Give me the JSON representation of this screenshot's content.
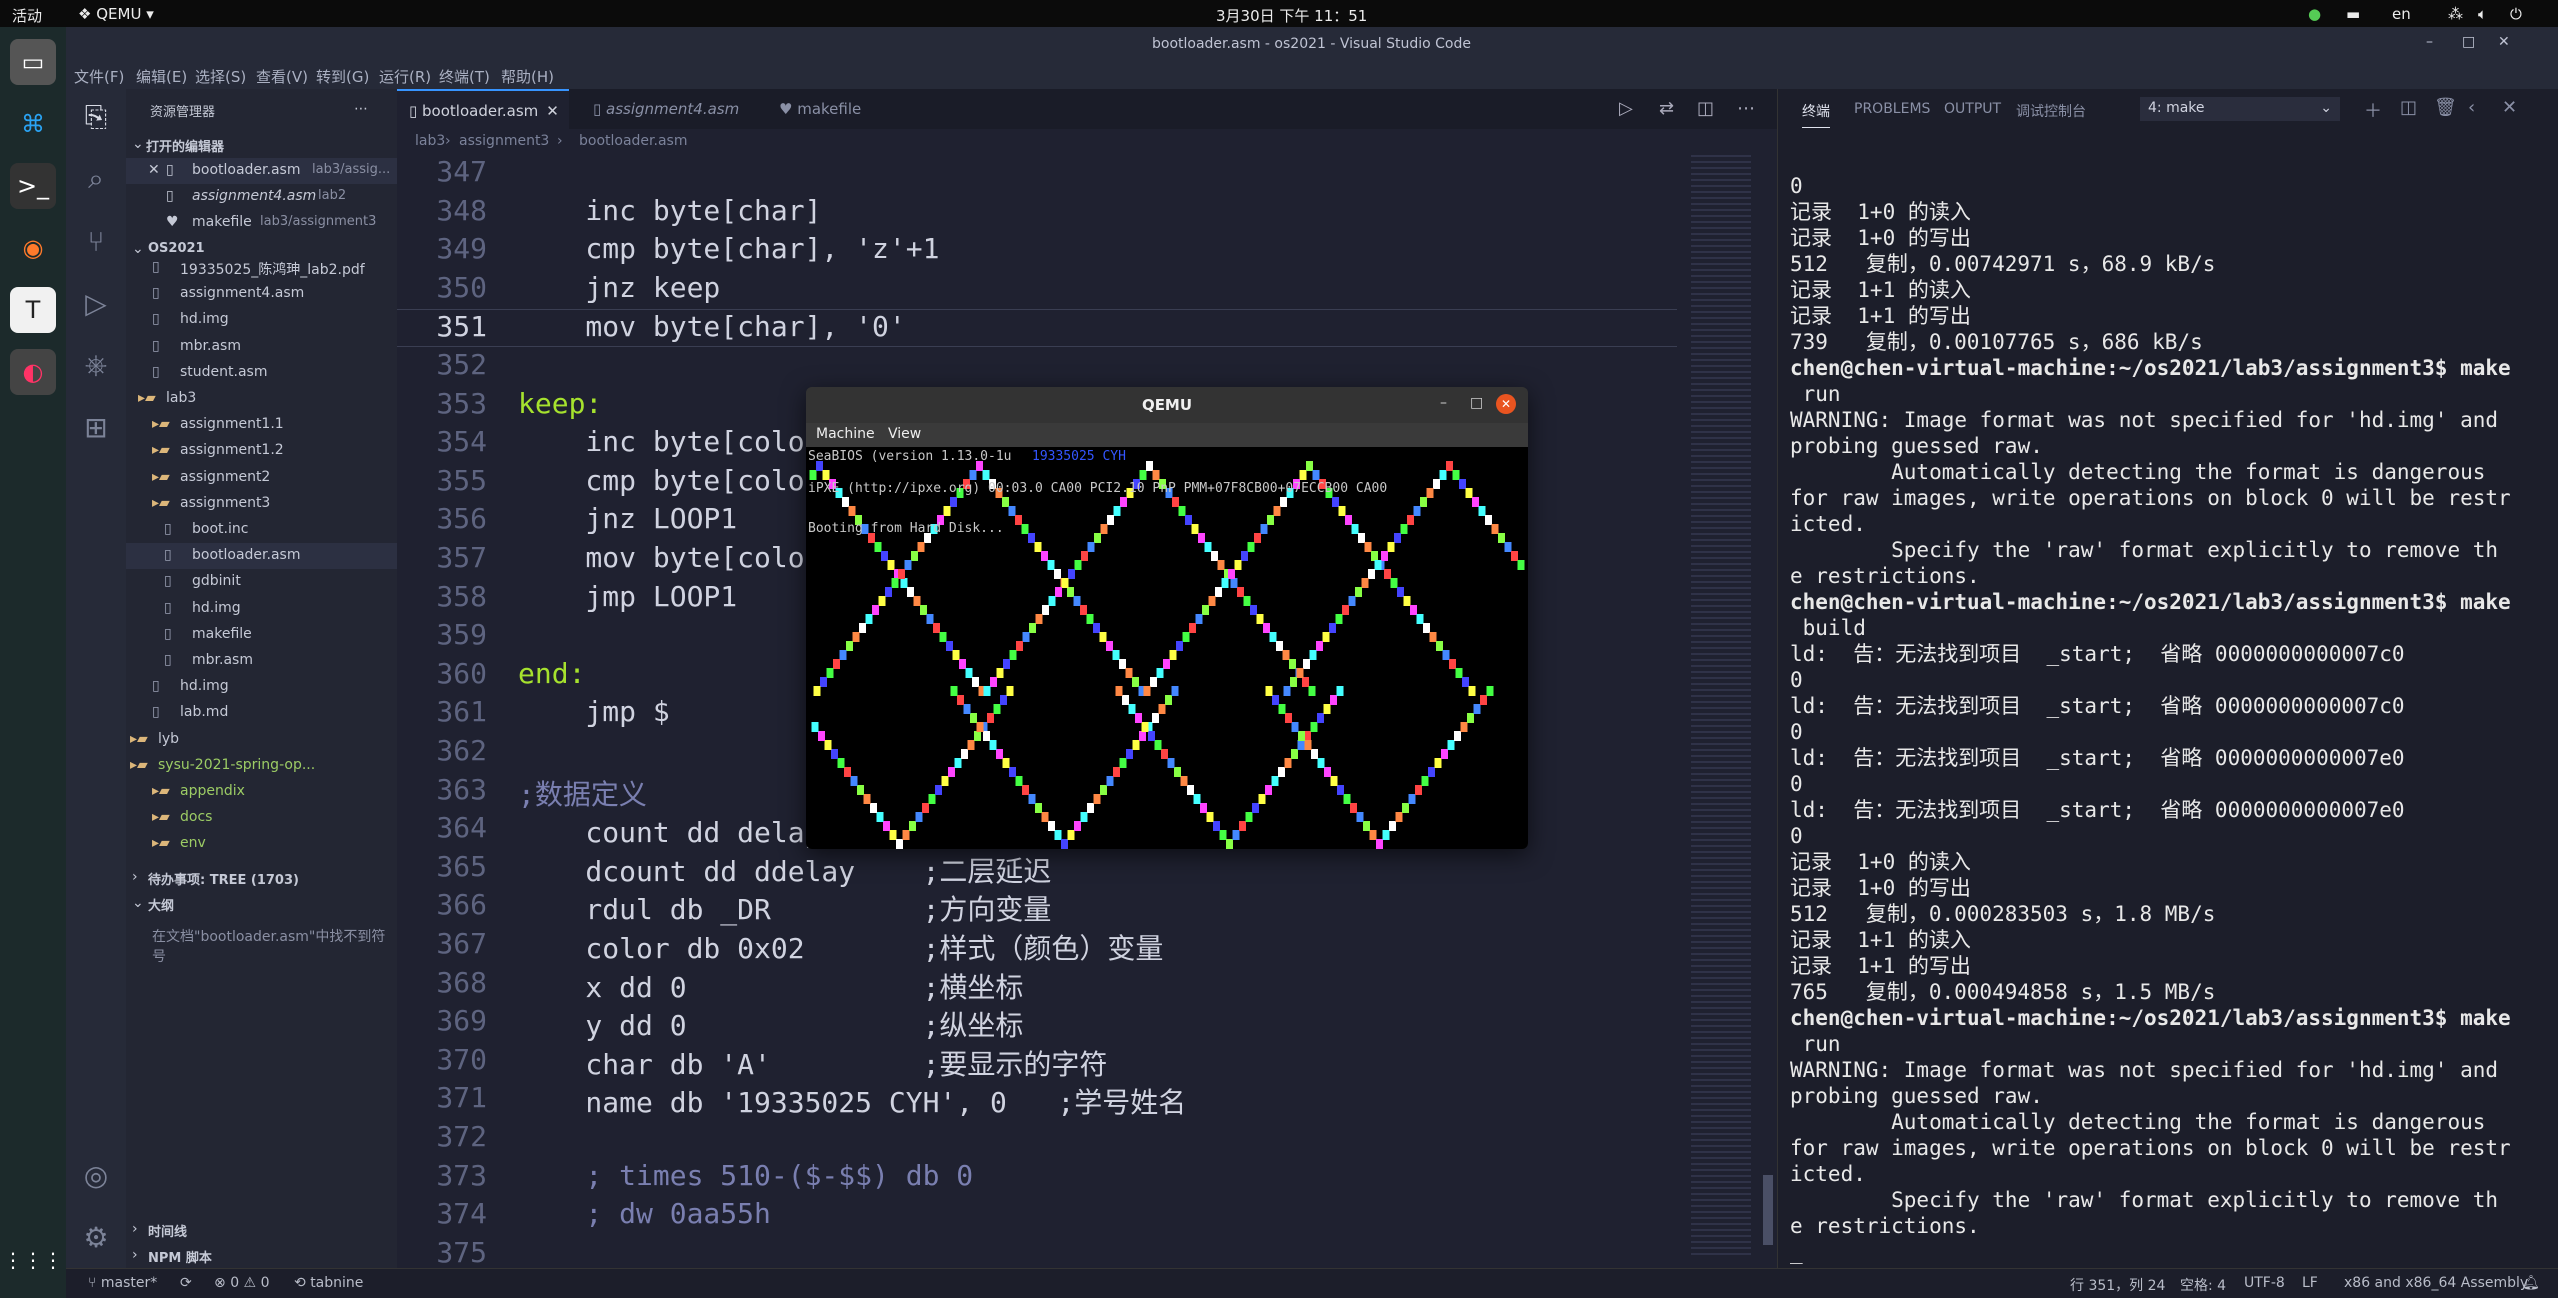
{
  "topbar": {
    "activities": "活动",
    "app": "QEMU",
    "clock": "3月30日 下午 11：51",
    "lang": "en"
  },
  "window": {
    "title": "bootloader.asm - os2021 - Visual Studio Code"
  },
  "menu": [
    "文件(F)",
    "编辑(E)",
    "选择(S)",
    "查看(V)",
    "转到(G)",
    "运行(R)",
    "终端(T)",
    "帮助(H)"
  ],
  "sidebar": {
    "header": "资源管理器",
    "open_editors": "打开的编辑器",
    "open_files": [
      {
        "name": "bootloader.asm",
        "path": "lab3/assig..."
      },
      {
        "name": "assignment4.asm",
        "path": "lab2"
      },
      {
        "name": "makefile",
        "path": "lab3/assignment3"
      }
    ],
    "project": "OS2021",
    "tree": [
      "19335025_陈鸿珅_lab2.pdf",
      "assignment4.asm",
      "hd.img",
      "mbr.asm",
      "student.asm",
      "lab3",
      "assignment1.1",
      "assignment1.2",
      "assignment2",
      "assignment3",
      "boot.inc",
      "bootloader.asm",
      "gdbinit",
      "hd.img",
      "makefile",
      "mbr.asm",
      "hd.img",
      "lab.md",
      "lyb",
      "sysu-2021-spring-op...",
      "appendix",
      "docs",
      "env"
    ],
    "todo": "待办事项: TREE (1703)",
    "outline": "大纲",
    "outline_msg": "在文档\"bootloader.asm\"中找不到符号",
    "timeline": "时间线",
    "npm": "NPM 脚本"
  },
  "tabs": [
    {
      "label": "bootloader.asm"
    },
    {
      "label": "assignment4.asm"
    },
    {
      "label": "makefile"
    }
  ],
  "breadcrumb": [
    "lab3",
    "assignment3",
    "bootloader.asm"
  ],
  "code": [
    {
      "n": "347",
      "t": ""
    },
    {
      "n": "348",
      "t": "    inc byte[char]"
    },
    {
      "n": "349",
      "t": "    cmp byte[char], 'z'+1"
    },
    {
      "n": "350",
      "t": "    jnz keep"
    },
    {
      "n": "351",
      "t": "    mov byte[char], '0'"
    },
    {
      "n": "352",
      "t": ""
    },
    {
      "n": "353",
      "t": "keep:"
    },
    {
      "n": "354",
      "t": "    inc byte[color]"
    },
    {
      "n": "355",
      "t": "    cmp byte[color], 0x10"
    },
    {
      "n": "356",
      "t": "    jnz LOOP1"
    },
    {
      "n": "357",
      "t": "    mov byte[color], 0x02"
    },
    {
      "n": "358",
      "t": "    jmp LOOP1"
    },
    {
      "n": "359",
      "t": ""
    },
    {
      "n": "360",
      "t": "end:"
    },
    {
      "n": "361",
      "t": "    jmp $"
    },
    {
      "n": "362",
      "t": ""
    },
    {
      "n": "363",
      "t": ";数据定义"
    },
    {
      "n": "364",
      "t": "    count dd delay      ;一层延迟"
    },
    {
      "n": "365",
      "t": "    dcount dd ddelay    ;二层延迟"
    },
    {
      "n": "366",
      "t": "    rdul db _DR         ;方向变量"
    },
    {
      "n": "367",
      "t": "    color db 0x02       ;样式（颜色）变量"
    },
    {
      "n": "368",
      "t": "    x dd 0              ;横坐标"
    },
    {
      "n": "369",
      "t": "    y dd 0              ;纵坐标"
    },
    {
      "n": "370",
      "t": "    char db 'A'         ;要显示的字符"
    },
    {
      "n": "371",
      "t": "    name db '19335025 CYH', 0   ;学号姓名"
    },
    {
      "n": "372",
      "t": ""
    },
    {
      "n": "373",
      "t": "    ; times 510-($-$$) db 0"
    },
    {
      "n": "374",
      "t": "    ; dw 0aa55h"
    },
    {
      "n": "375",
      "t": ""
    }
  ],
  "panel": {
    "tabs": [
      "终端",
      "PROBLEMS",
      "OUTPUT",
      "调试控制台"
    ],
    "terminal_select": "4: make",
    "lines": [
      "0",
      "记录  1+0 的读入",
      "记录  1+0 的写出",
      "512   复制，0.00742971 s，68.9 kB/s",
      "记录  1+1 的读入",
      "记录  1+1 的写出",
      "739   复制，0.00107765 s，686 kB/s",
      "chen@chen-virtual-machine:~/os2021/lab3/assignment3$ make",
      " run",
      "WARNING: Image format was not specified for 'hd.img' and",
      "probing guessed raw.",
      "        Automatically detecting the format is dangerous",
      "for raw images, write operations on block 0 will be restr",
      "icted.",
      "        Specify the 'raw' format explicitly to remove th",
      "e restrictions.",
      "chen@chen-virtual-machine:~/os2021/lab3/assignment3$ make",
      " build",
      "ld:  告：无法找到项目  _start;  省略 0000000000007c0",
      "0",
      "ld:  告：无法找到项目  _start;  省略 0000000000007c0",
      "0",
      "ld:  告：无法找到项目  _start;  省略 0000000000007e0",
      "0",
      "ld:  告：无法找到项目  _start;  省略 0000000000007e0",
      "0",
      "记录  1+0 的读入",
      "记录  1+0 的写出",
      "512   复制，0.000283503 s，1.8 MB/s",
      "记录  1+1 的读入",
      "记录  1+1 的写出",
      "765   复制，0.000494858 s，1.5 MB/s",
      "chen@chen-virtual-machine:~/os2021/lab3/assignment3$ make",
      " run",
      "WARNING: Image format was not specified for 'hd.img' and",
      "probing guessed raw.",
      "        Automatically detecting the format is dangerous",
      "for raw images, write operations on block 0 will be restr",
      "icted.",
      "        Specify the 'raw' format explicitly to remove th",
      "e restrictions.",
      "_"
    ]
  },
  "qemu": {
    "title": "QEMU",
    "menu": [
      "Machine",
      "View"
    ],
    "bios": "SeaBIOS (version 1.13.0-1u",
    "name": "19335025 CYH",
    "ipxe": "iPXE (http://ipxe.org) 00:03.0 CA00 PCI2.10 PnP PMM+07F8CB00+07ECCB00 CA00",
    "booting": "Booting from Hard Disk..."
  },
  "status": {
    "branch": "master*",
    "errors": "0",
    "warnings": "0",
    "tabnine": "tabnine",
    "pos": "行 351，列 24",
    "spaces": "空格: 4",
    "enc": "UTF-8",
    "eol": "LF",
    "lang": "x86 and x86_64 Assembly"
  },
  "colors": {
    "accent": "#3794ff",
    "prompt": "#ffffff",
    "keyword": "#c77dbb",
    "string": "#c3e88d",
    "label": "#a6e22e",
    "comment": "#7a7fb0"
  }
}
